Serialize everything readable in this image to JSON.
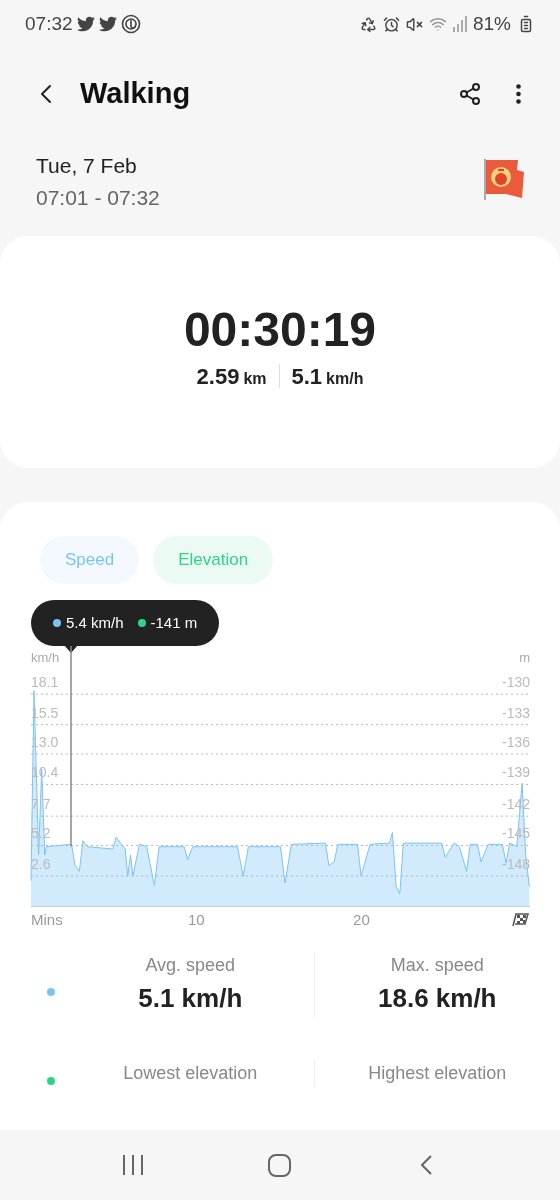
{
  "status_bar": {
    "time": "07:32",
    "battery": "81%"
  },
  "header": {
    "title": "Walking"
  },
  "session": {
    "date": "Tue, 7 Feb",
    "time_range": "07:01 - 07:32"
  },
  "summary": {
    "duration": "00:30:19",
    "distance": {
      "value": "2.59",
      "unit": "km"
    },
    "speed": {
      "value": "5.1",
      "unit": "km/h"
    }
  },
  "chips": [
    {
      "label": "Speed",
      "on": true,
      "color": "#7cc3f5"
    },
    {
      "label": "Elevation",
      "on": true,
      "color": "#2fd48a"
    }
  ],
  "tooltip": {
    "items": [
      {
        "text": "5.4 km/h",
        "color": "#7cc3f5"
      },
      {
        "text": "-141 m",
        "color": "#2fd48a"
      }
    ]
  },
  "chart": {
    "right_axis": {
      "unit": "m",
      "ticks": [
        "-130",
        "-133",
        "-136",
        "-139",
        "-142",
        "-145",
        "-148"
      ]
    },
    "chart_data": {
      "type": "area",
      "ylabel": "km/h",
      "xlim": [
        0,
        30.2
      ],
      "ylim": [
        0,
        22.2
      ],
      "grid": true,
      "xticks": [
        {
          "value": 0,
          "label": "Mins"
        },
        10,
        20
      ],
      "yticks": [
        2.6,
        5.2,
        7.7,
        10.4,
        {
          "value": 13,
          "label": "13.0"
        },
        15.5,
        18.1
      ],
      "x": [
        0,
        0.18,
        0.46,
        0.65,
        0.83,
        0.93,
        2.45,
        2.67,
        2.93,
        3.14,
        3.42,
        4.94,
        5.15,
        5.7,
        5.85,
        6.02,
        6.17,
        6.56,
        7.0,
        7.47,
        7.75,
        9.27,
        9.48,
        9.8,
        12.5,
        12.84,
        13.16,
        15.1,
        15.37,
        15.76,
        17.82,
        18.03,
        18.35,
        18.57,
        19.76,
        19.98,
        20.52,
        21.7,
        21.87,
        22.1,
        22.32,
        22.54,
        24.85,
        25.07,
        25.61,
        25.93,
        26.36,
        26.58,
        27.02,
        27.24,
        27.67,
        28.53,
        28.75,
        28.97,
        29.4,
        29.72,
        29.94,
        30.16
      ],
      "series": [
        {
          "color": "#7cc3f5",
          "values": [
            2.2,
            18.4,
            4.4,
            11.7,
            4.4,
            5.1,
            5.3,
            3.5,
            3.0,
            5.6,
            5.1,
            4.9,
            5.9,
            4.9,
            2.6,
            4.4,
            2.6,
            5.3,
            5.1,
            1.8,
            5.1,
            5.1,
            4.0,
            5.1,
            5.1,
            2.6,
            5.1,
            5.1,
            2.0,
            5.3,
            5.4,
            3.5,
            3.8,
            5.3,
            5.3,
            2.6,
            5.3,
            5.4,
            6.3,
            1.7,
            1.1,
            5.4,
            5.4,
            4.2,
            5.4,
            5.1,
            3.0,
            5.3,
            5.3,
            3.8,
            5.3,
            5.3,
            3.7,
            5.4,
            5.1,
            10.5,
            4.4,
            1.7
          ]
        }
      ]
    }
  },
  "stats": [
    {
      "color": "#7cc3f5",
      "items": [
        {
          "label": "Avg. speed",
          "value": "5.1 km/h"
        },
        {
          "label": "Max. speed",
          "value": "18.6 km/h"
        }
      ]
    },
    {
      "color": "#2fd48a",
      "items": [
        {
          "label": "Lowest elevation"
        },
        {
          "label": "Highest elevation"
        }
      ]
    }
  ]
}
